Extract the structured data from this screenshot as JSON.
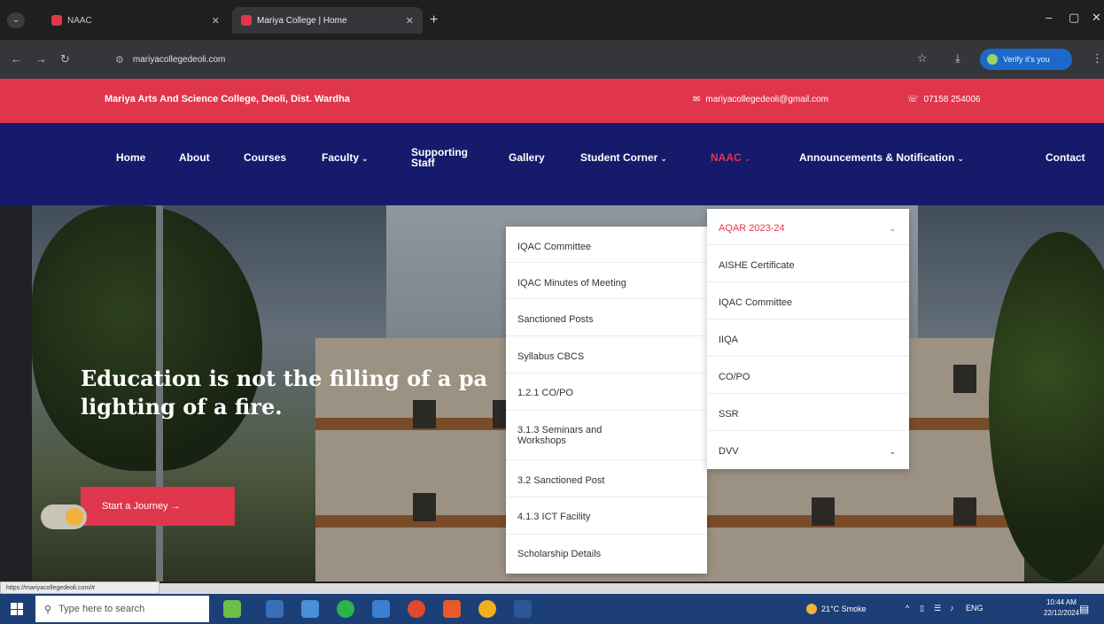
{
  "browser": {
    "tab1_title": "NAAC",
    "tab2_title": "Mariya College | Home",
    "url": "mariyacollegedeoli.com",
    "verify_label": "Verify it's you"
  },
  "site": {
    "college_name": "Mariya Arts And Science College, Deoli, Dist. Wardha",
    "email": "mariyacollegedeoli@gmail.com",
    "phone": "07158 254006"
  },
  "nav": {
    "home": "Home",
    "about": "About",
    "courses": "Courses",
    "faculty": "Faculty",
    "supporting_1": "Supporting",
    "supporting_2": "Staff",
    "gallery": "Gallery",
    "student_corner": "Student Corner",
    "naac": "NAAC",
    "announcements": "Announcements & Notification",
    "contact": "Contact"
  },
  "hero": {
    "headline_1": "Education is not the filling of a pa",
    "headline_2": "lighting of a fire.",
    "cta": "Start a Journey →"
  },
  "naac_menu": {
    "left": [
      "IQAC Committee",
      "IQAC Minutes of Meeting",
      "Sanctioned Posts",
      "Syllabus CBCS",
      "1.2.1 CO/PO",
      "3.1.3 Seminars and",
      "Workshops",
      "3.2 Sanctioned Post",
      "4.1.3 ICT Facility",
      "Scholarship Details"
    ],
    "right": [
      "AQAR 2023-24",
      "AISHE Certificate",
      "IQAC Committee",
      "IIQA",
      "CO/PO",
      "SSR",
      "DVV"
    ]
  },
  "status": {
    "url": "https://mariyacollegedeoli.com/#"
  },
  "taskbar": {
    "search_placeholder": "Type here to search",
    "weather": "21°C  Smoke",
    "lang": "ENG",
    "time": "10:44 AM",
    "date": "22/12/2024"
  },
  "colors": {
    "accent": "#e0364c",
    "navy": "#151a6b"
  }
}
